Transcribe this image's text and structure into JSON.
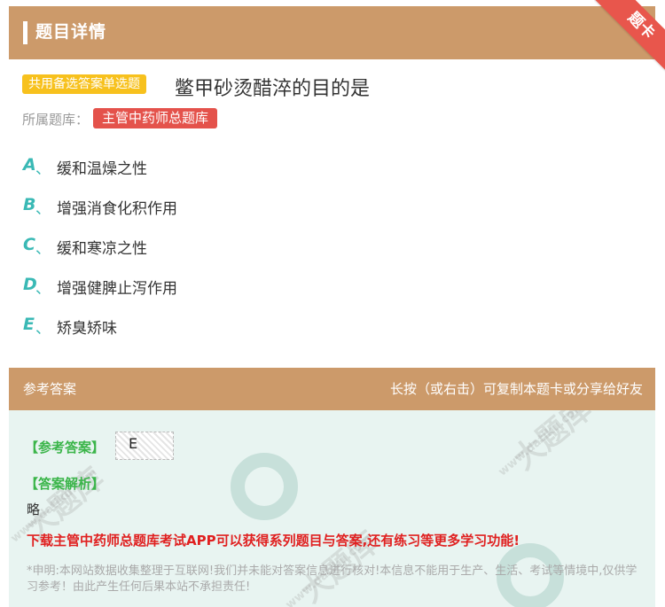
{
  "header": {
    "title": "题目详情",
    "ribbon": "题卡"
  },
  "question": {
    "type_badge": "共用备选答案单选题",
    "title": "鳖甲砂烫醋淬的目的是",
    "bank_label": "所属题库：",
    "bank_name": "主管中药师总题库"
  },
  "options": [
    {
      "letter": "A",
      "sep": "、",
      "text": "缓和温燥之性"
    },
    {
      "letter": "B",
      "sep": "、",
      "text": "增强消食化积作用"
    },
    {
      "letter": "C",
      "sep": "、",
      "text": "缓和寒凉之性"
    },
    {
      "letter": "D",
      "sep": "、",
      "text": "增强健脾止泻作用"
    },
    {
      "letter": "E",
      "sep": "、",
      "text": "矫臭矫味"
    }
  ],
  "answer": {
    "section_title": "参考答案",
    "hint": "长按（或右击）可复制本题卡或分享给好友",
    "key_label": "【参考答案】",
    "key_value": "E",
    "analysis_label": "【答案解析】",
    "analysis_text": "略",
    "promo": "下载主管中药师总题库考试APP可以获得系列题目与答案,还有练习等更多学习功能!",
    "disclaimer": "*申明:本网站数据收集整理于互联网!我们并未能对答案信息进行核对!本信息不能用于生产、生活、考试等情境中,仅供学习参考！由此产生任何后果本站不承担责任!"
  },
  "watermark": {
    "brand": "大题库",
    "url": "www.datiku.com"
  },
  "colors": {
    "header_bg": "#cc9a6a",
    "ribbon": "#e8564c",
    "type_badge": "#f7c11d",
    "bank_tag": "#e4524b",
    "option_letter": "#3ab9b5",
    "answer_label": "#3bb54a",
    "promo": "#e02020",
    "answer_bg": "#e8f4f1"
  }
}
